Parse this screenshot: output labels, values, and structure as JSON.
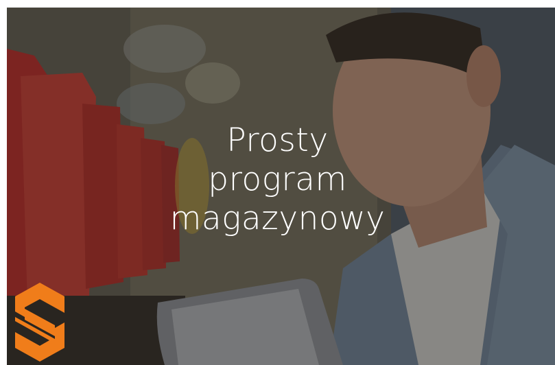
{
  "hero": {
    "headline_lines": [
      "Prosty",
      "program",
      "magazynowy"
    ]
  },
  "colors": {
    "overlay": "#141414",
    "logo": "#f07d1a",
    "headline": "#ffffff"
  },
  "icons": {
    "logo": "orange-s-logo"
  }
}
